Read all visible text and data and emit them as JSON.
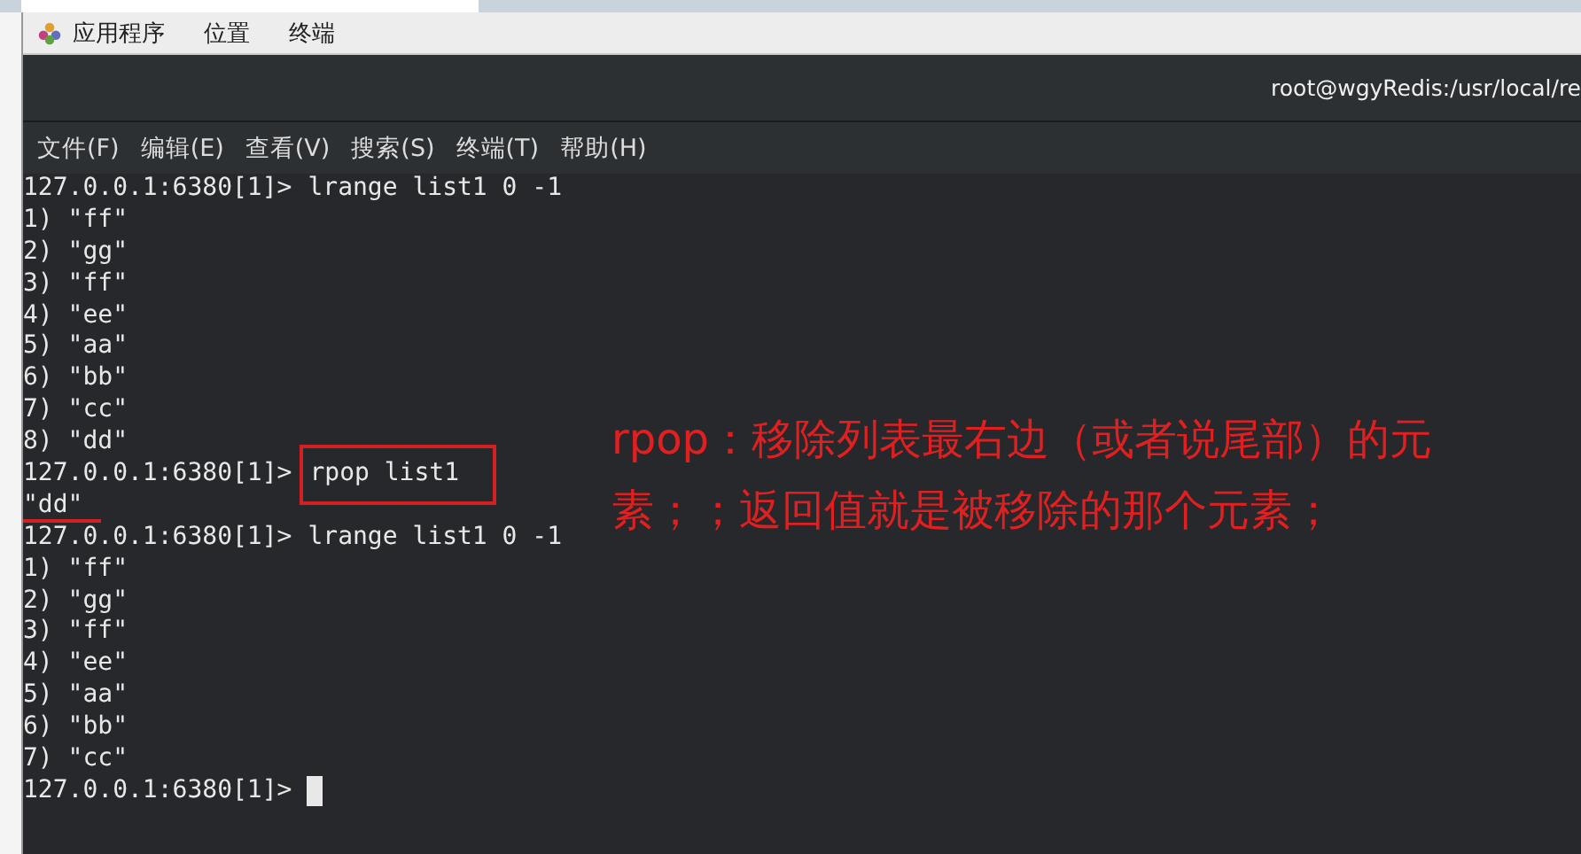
{
  "top_panel": {
    "items": [
      "应用程序",
      "位置",
      "终端"
    ]
  },
  "window": {
    "title": "root@wgyRedis:/usr/local/re"
  },
  "menu": [
    "文件(F)",
    "编辑(E)",
    "查看(V)",
    "搜索(S)",
    "终端(T)",
    "帮助(H)"
  ],
  "terminal": {
    "lines": [
      {
        "kind": "prompt",
        "prompt": "127.0.0.1:6380[1]>",
        "command": "lrange list1 0 -1",
        "boxed": false,
        "cursor": false
      },
      {
        "kind": "output",
        "text": "1) \"ff\"",
        "underlined": false
      },
      {
        "kind": "output",
        "text": "2) \"gg\"",
        "underlined": false
      },
      {
        "kind": "output",
        "text": "3) \"ff\"",
        "underlined": false
      },
      {
        "kind": "output",
        "text": "4) \"ee\"",
        "underlined": false
      },
      {
        "kind": "output",
        "text": "5) \"aa\"",
        "underlined": false
      },
      {
        "kind": "output",
        "text": "6) \"bb\"",
        "underlined": false
      },
      {
        "kind": "output",
        "text": "7) \"cc\"",
        "underlined": false
      },
      {
        "kind": "output",
        "text": "8) \"dd\"",
        "underlined": false
      },
      {
        "kind": "prompt",
        "prompt": "127.0.0.1:6380[1]>",
        "command": "rpop list1",
        "boxed": true,
        "cursor": false
      },
      {
        "kind": "output",
        "text": "\"dd\"",
        "underlined": true
      },
      {
        "kind": "prompt",
        "prompt": "127.0.0.1:6380[1]>",
        "command": "lrange list1 0 -1",
        "boxed": false,
        "cursor": false
      },
      {
        "kind": "output",
        "text": "1) \"ff\"",
        "underlined": false
      },
      {
        "kind": "output",
        "text": "2) \"gg\"",
        "underlined": false
      },
      {
        "kind": "output",
        "text": "3) \"ff\"",
        "underlined": false
      },
      {
        "kind": "output",
        "text": "4) \"ee\"",
        "underlined": false
      },
      {
        "kind": "output",
        "text": "5) \"aa\"",
        "underlined": false
      },
      {
        "kind": "output",
        "text": "6) \"bb\"",
        "underlined": false
      },
      {
        "kind": "output",
        "text": "7) \"cc\"",
        "underlined": false
      },
      {
        "kind": "prompt",
        "prompt": "127.0.0.1:6380[1]>",
        "boxed": false,
        "cursor": true
      }
    ]
  },
  "annotation": "rpop：移除列表最右边（或者说尾部）的元素；；返回值就是被移除的那个元素；"
}
